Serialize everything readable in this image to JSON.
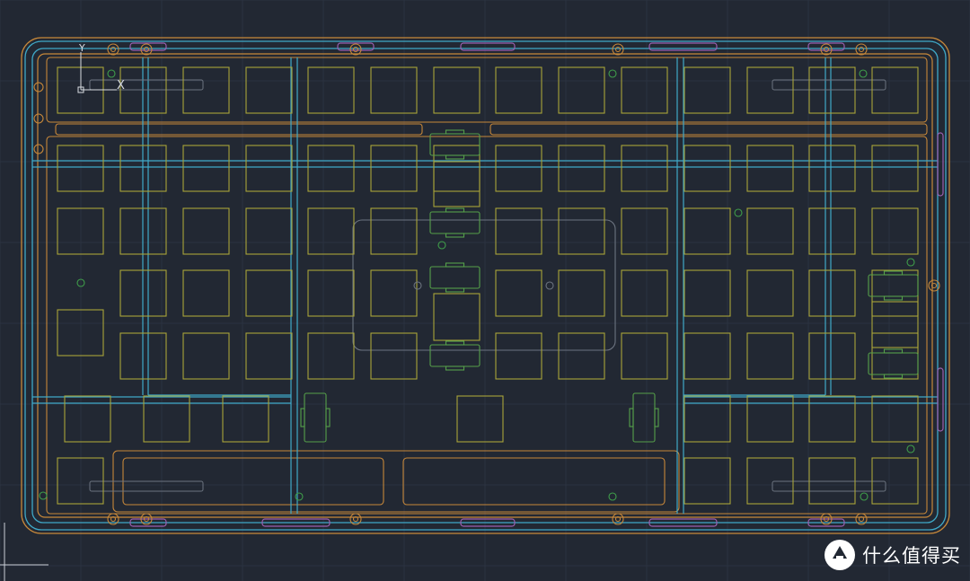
{
  "ucs": {
    "y_label": "Y",
    "x_label": "X"
  },
  "watermark": {
    "text": "什么值得买",
    "icon": "smzdm-logo-icon"
  },
  "colors": {
    "background": "#222833",
    "grid": "#2b3240",
    "key_outline": "#a8a43a",
    "outline_cyan": "#3fa9c8",
    "outline_orange": "#c7883a",
    "outline_purple": "#9b5fb0",
    "hole_green": "#3f9e4a",
    "outline_gray": "#6c7480",
    "stab_green": "#56a04a"
  }
}
